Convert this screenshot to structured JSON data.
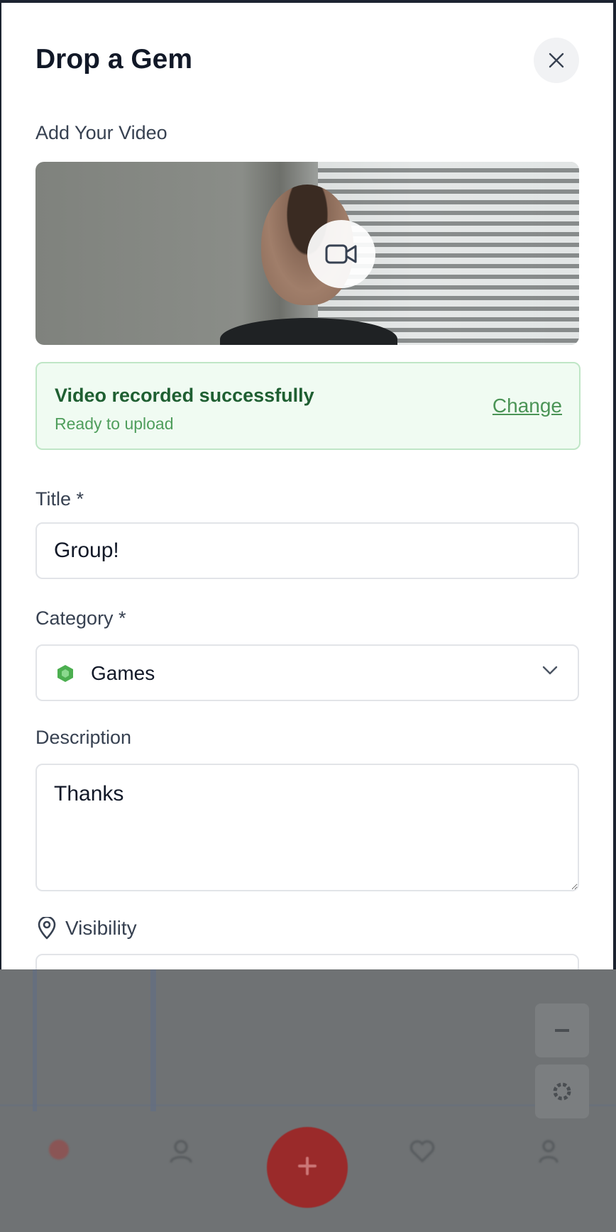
{
  "modal": {
    "title": "Drop a Gem",
    "close_icon": "close-icon"
  },
  "video": {
    "section_label": "Add Your Video",
    "camera_icon": "video-camera-icon"
  },
  "status": {
    "title": "Video recorded successfully",
    "subtitle": "Ready to upload",
    "change_label": "Change",
    "color": "#1f5f32"
  },
  "form": {
    "title_label": "Title *",
    "title_value": "Group!",
    "category_label": "Category *",
    "category_value": "Games",
    "category_icon": "hexagon-icon",
    "category_icon_color": "#4caf50",
    "description_label": "Description",
    "description_value": "Thanks",
    "visibility_label": "Visibility",
    "visibility_icon": "location-pin-icon"
  }
}
